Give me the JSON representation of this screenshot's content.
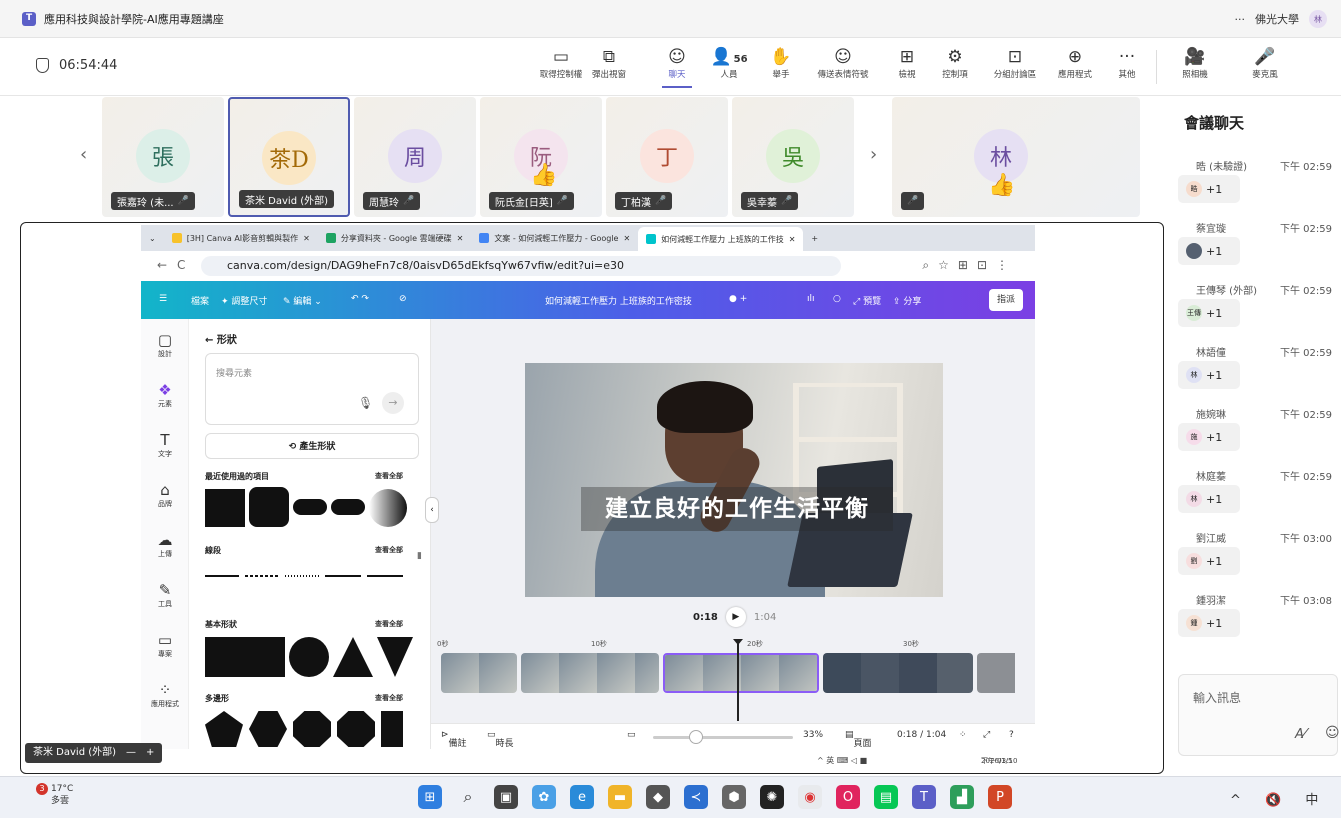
{
  "window": {
    "title": "應用科技與設計學院-AI應用專題講座",
    "menu": "···",
    "org": "佛光大學",
    "user_initial": "林"
  },
  "toolbar": {
    "timer": "06:54:44",
    "tools": [
      {
        "label": "取得控制權",
        "icon": "▭"
      },
      {
        "label": "彈出視窗",
        "icon": "⧉"
      },
      {
        "label": "聊天",
        "icon": "☺",
        "active": true
      },
      {
        "label": "人員",
        "icon": "👤",
        "count": "56"
      },
      {
        "label": "舉手",
        "icon": "✋"
      },
      {
        "label": "傳送表情符號",
        "icon": "☺"
      },
      {
        "label": "檢視",
        "icon": "⊞"
      },
      {
        "label": "控制項",
        "icon": "⚙"
      },
      {
        "label": "分組討論區",
        "icon": "⊡"
      },
      {
        "label": "應用程式",
        "icon": "⊕"
      },
      {
        "label": "其他",
        "icon": "···"
      },
      {
        "label": "照相機",
        "icon": "🎥"
      },
      {
        "label": "麥克風",
        "icon": "🎤"
      }
    ]
  },
  "gallery": {
    "tiles": [
      {
        "initial": "張",
        "name": "張嘉玲 (未...",
        "bg": "#dcefe8",
        "fg": "#2e6f5e"
      },
      {
        "initial": "茶D",
        "name": "茶米 David (外部)",
        "bg": "#fae7c5",
        "fg": "#a36a08"
      },
      {
        "initial": "周",
        "name": "周慧玲",
        "bg": "#e6e0f3",
        "fg": "#6b4ea0"
      },
      {
        "initial": "阮",
        "name": "阮氏金[日英]",
        "bg": "#f4e4ee",
        "fg": "#9a5c7e"
      },
      {
        "initial": "丁",
        "name": "丁柏漢",
        "bg": "#fbe4de",
        "fg": "#b04b32"
      },
      {
        "initial": "吳",
        "name": "吳幸蓁",
        "bg": "#e0f1d8",
        "fg": "#3f8a2a"
      },
      {
        "initial": "林",
        "name": "",
        "bg": "#e6e0f3",
        "fg": "#6b4ea0"
      }
    ]
  },
  "chat": {
    "title": "會議聊天",
    "messages": [
      {
        "sender": "晧 (未驗證)",
        "time": "下午 02:59",
        "avatar": "晧",
        "react": "+1",
        "color": "#f6dccd"
      },
      {
        "sender": "蔡宜璇",
        "time": "下午 02:59",
        "avatar": "",
        "react": "+1",
        "color": "#556070"
      },
      {
        "sender": "王傳琴 (外部)",
        "time": "下午 02:59",
        "avatar": "王傳",
        "react": "+1",
        "color": "#d9ecd6"
      },
      {
        "sender": "林語僮",
        "time": "下午 02:59",
        "avatar": "林",
        "react": "+1",
        "color": "#dfe1f4"
      },
      {
        "sender": "施婉琳",
        "time": "下午 02:59",
        "avatar": "施",
        "react": "+1",
        "color": "#f6dcea"
      },
      {
        "sender": "林庭蓁",
        "time": "下午 02:59",
        "avatar": "林",
        "react": "+1",
        "color": "#f3dbe6"
      },
      {
        "sender": "劉江威",
        "time": "下午 03:00",
        "avatar": "劉",
        "react": "+1",
        "color": "#f7dede"
      },
      {
        "sender": "鍾羽潔",
        "time": "下午 03:08",
        "avatar": "鍾",
        "react": "+1",
        "color": "#f6e1d4"
      }
    ],
    "input_placeholder": "輸入訊息"
  },
  "browser": {
    "tabs": [
      {
        "label": "[3H] Canva AI影音剪輯與製作",
        "color": "#f7c22a"
      },
      {
        "label": "分享資料夾 - Google 雲端硬碟",
        "color": "#1ea362"
      },
      {
        "label": "文案 - 如何減輕工作壓力 - Google",
        "color": "#4285f4"
      },
      {
        "label": "如何減輕工作壓力 上班族的工作技",
        "color": "#00c4cc",
        "active": true
      }
    ],
    "url": "canva.com/design/DAG9heFn7c8/0aisvD65dEkfsqYw67vfiw/edit?ui=e30"
  },
  "canva": {
    "menu": [
      "檔案",
      "✦ 調整尺寸",
      "✎ 編輯 ⌄"
    ],
    "doc_title": "如何減輕工作壓力 上班族的工作密技",
    "present": "預覽",
    "share": "分享",
    "action": "指派",
    "rail": [
      {
        "label": "設計",
        "icon": "▢"
      },
      {
        "label": "元素",
        "icon": "❖"
      },
      {
        "label": "文字",
        "icon": "T"
      },
      {
        "label": "品牌",
        "icon": "⌂"
      },
      {
        "label": "上傳",
        "icon": "☁"
      },
      {
        "label": "工具",
        "icon": "✎"
      },
      {
        "label": "專案",
        "icon": "▭"
      },
      {
        "label": "應用程式",
        "icon": "⁘"
      }
    ],
    "panel": {
      "back": "← 形狀",
      "search_placeholder": "搜尋元素",
      "generate": "⟲ 產生形狀",
      "sections": [
        {
          "title": "最近使用過的項目",
          "all": "查看全部"
        },
        {
          "title": "線段",
          "all": "查看全部"
        },
        {
          "title": "基本形狀",
          "all": "查看全部"
        },
        {
          "title": "多邊形",
          "all": "查看全部"
        }
      ]
    },
    "caption": "建立良好的工作生活平衡",
    "time_now": "0:18",
    "time_total": "1:04",
    "ticks": [
      "0秒",
      "10秒",
      "20秒",
      "30秒"
    ],
    "footer": {
      "notes": "備註",
      "duration": "時長",
      "zoom": "33%",
      "page": "頁面",
      "time": "0:18 / 1:04"
    }
  },
  "share_footer": {
    "presenter": "茶米 David (外部)",
    "tray": "^  英  ⌨  ◁  ■",
    "clock": "下午 03:10",
    "date": "2026/1/5"
  },
  "taskbar": {
    "weather_temp": "17°C",
    "weather_desc": "多雲",
    "weather_badge": "3",
    "tray_text": "^ 🔇 中"
  }
}
